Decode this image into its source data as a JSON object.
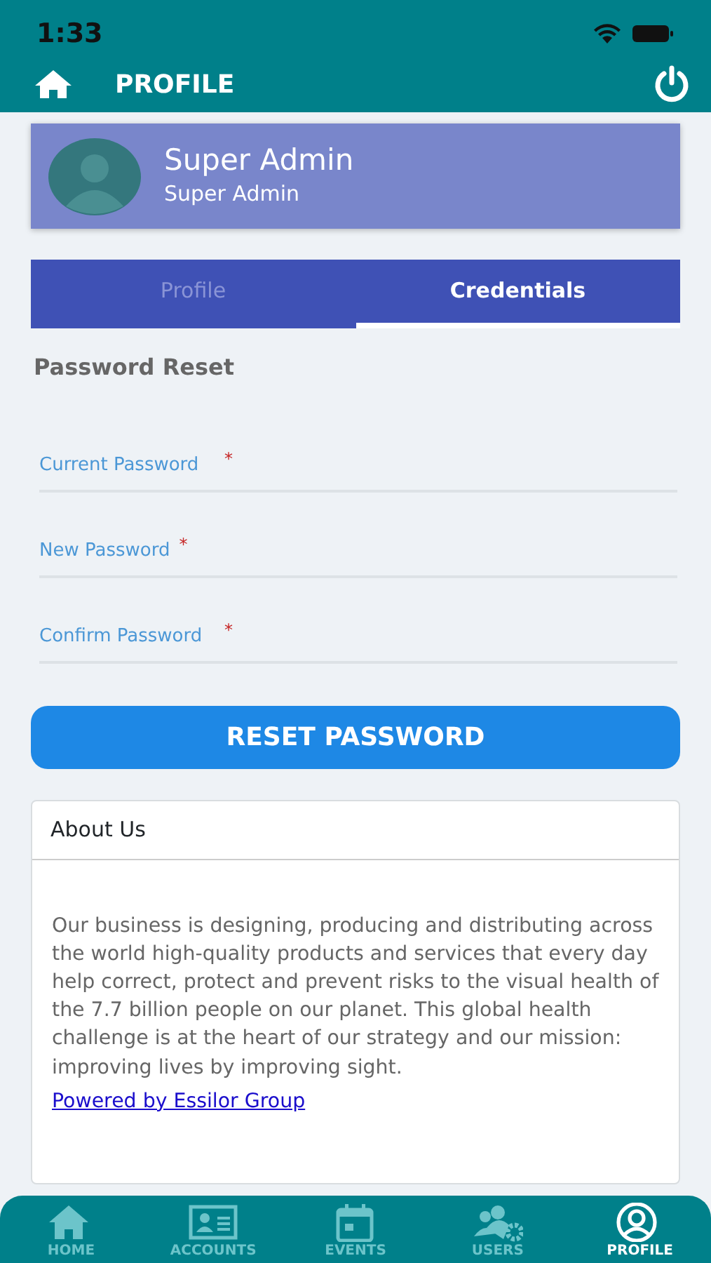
{
  "status_bar": {
    "time": "1:33"
  },
  "header": {
    "title": "PROFILE"
  },
  "profile_card": {
    "name": "Super Admin",
    "role": "Super Admin"
  },
  "tabs": [
    {
      "label": "Profile",
      "selected": false
    },
    {
      "label": "Credentials",
      "selected": true
    }
  ],
  "section_title": "Password Reset",
  "fields": [
    {
      "placeholder": "Current Password",
      "required_mark": "*"
    },
    {
      "placeholder": "New Password",
      "required_mark": "*"
    },
    {
      "placeholder": "Confirm Password",
      "required_mark": "*"
    }
  ],
  "reset_button": "RESET PASSWORD",
  "about": {
    "title": "About Us",
    "text": "Our business is designing, producing and distributing across the world high-quality products and services that every day help correct, protect and prevent risks to the visual health of the 7.7 billion people on our planet. This global health challenge is at the heart of our strategy and our mission: improving lives by improving sight.",
    "link": "Powered by Essilor Group"
  },
  "bottom_nav": [
    {
      "kind": "home",
      "label": "HOME",
      "selected": false
    },
    {
      "kind": "accounts",
      "label": "ACCOUNTS",
      "selected": false
    },
    {
      "kind": "events",
      "label": "EVENTS",
      "selected": false
    },
    {
      "kind": "users",
      "label": "USERS",
      "selected": false
    },
    {
      "kind": "profile",
      "label": "PROFILE",
      "selected": true
    }
  ]
}
